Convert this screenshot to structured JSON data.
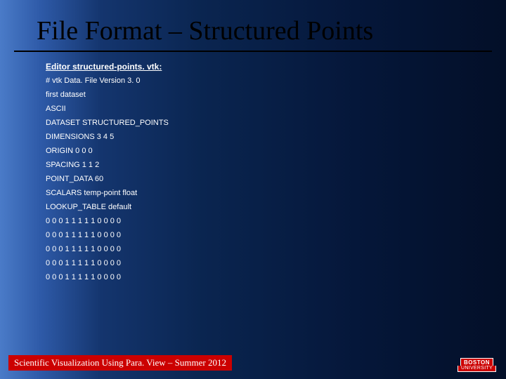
{
  "title": "File Format – Structured Points",
  "editor_label": "Editor structured-points. vtk:",
  "lines": [
    "# vtk Data. File Version 3. 0",
    "first dataset",
    "ASCII",
    "DATASET STRUCTURED_POINTS",
    "DIMENSIONS 3 4 5",
    "ORIGIN 0 0 0",
    "SPACING 1 1 2",
    "POINT_DATA 60",
    "SCALARS temp-point float",
    "LOOKUP_TABLE default",
    "0 0 0 1 1 1 1 1 0 0 0 0",
    "0 0 0 1 1 1 1 1 0 0 0 0",
    "0 0 0 1 1 1 1 1 0 0 0 0",
    "0 0 0 1 1 1 1 1 0 0 0 0",
    "0 0 0 1 1 1 1 1 0 0 0 0"
  ],
  "footer": "Scientific Visualization Using Para. View – Summer 2012",
  "logo": {
    "top": "BOSTON",
    "bottom": "UNIVERSITY"
  }
}
